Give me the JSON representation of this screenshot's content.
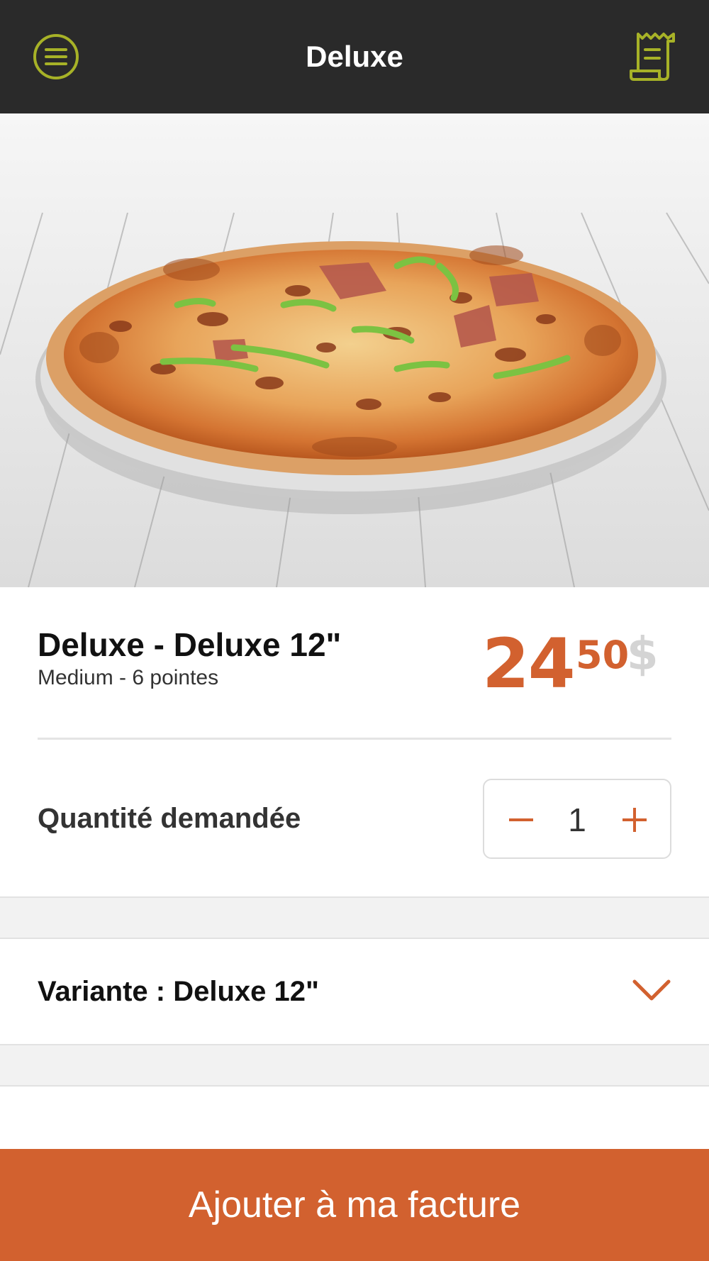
{
  "header": {
    "title": "Deluxe",
    "menu_icon": "menu-circle-icon",
    "receipt_icon": "receipt-icon",
    "accent_color": "#a7b227",
    "background_color": "#2a2a2a"
  },
  "product": {
    "image": "pizza-photo",
    "name": "Deluxe - Deluxe 12\"",
    "subtitle": "Medium - 6 pointes",
    "price": {
      "integer": "24",
      "decimal": "50",
      "currency": "$"
    }
  },
  "quantity": {
    "label": "Quantité demandée",
    "value": "1",
    "minus_icon": "minus-icon",
    "plus_icon": "plus-icon"
  },
  "variant": {
    "label": "Variante : Deluxe 12\"",
    "icon": "chevron-down-icon"
  },
  "add_button": {
    "label": "Ajouter à ma facture"
  },
  "colors": {
    "accent": "#d2612f",
    "currency_symbol": "#d4d4d4"
  }
}
